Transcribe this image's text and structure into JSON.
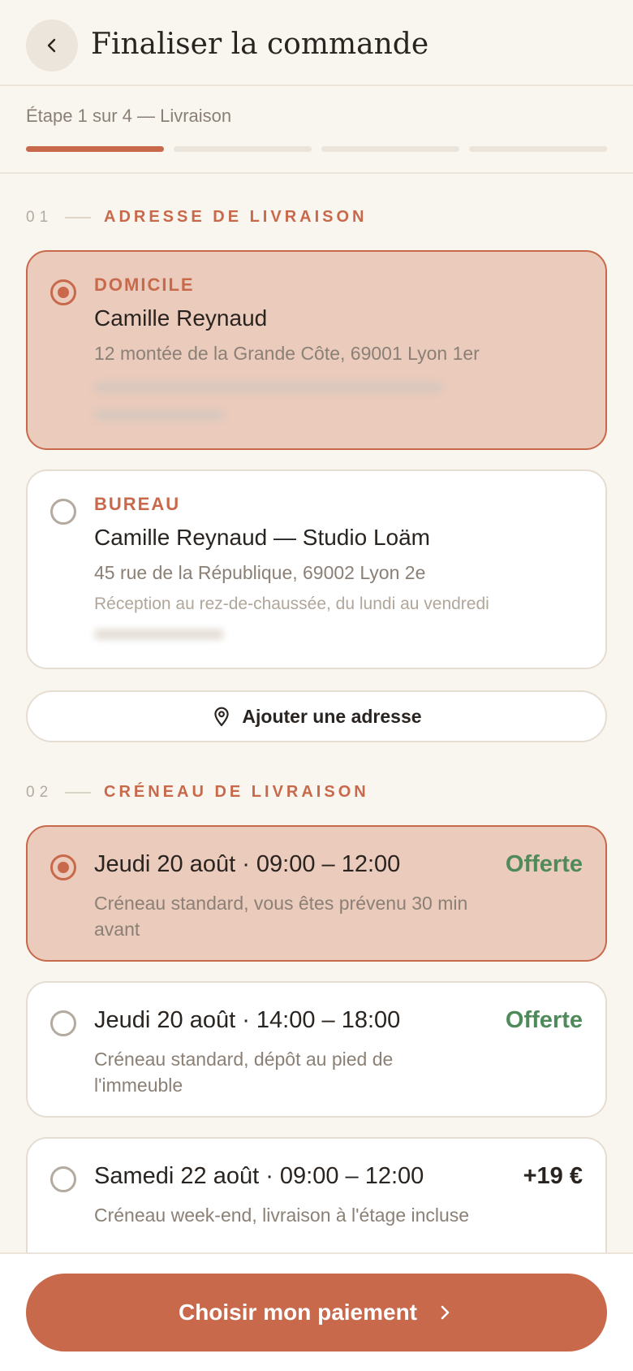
{
  "header": {
    "title": "Finaliser la commande",
    "back_icon": "chevron-left-icon"
  },
  "progress": {
    "label": "Étape 1 sur 4 — Livraison",
    "current_step": 1,
    "total_steps": 4
  },
  "sections": {
    "address": {
      "number": "01",
      "title": "ADRESSE DE LIVRAISON"
    },
    "slot": {
      "number": "02",
      "title": "CRÉNEAU DE LIVRAISON"
    }
  },
  "addresses": [
    {
      "tag": "DOMICILE",
      "name": "Camille Reynaud",
      "line": "12 montée de la Grande Côte, 69001 Lyon 1er",
      "note": "",
      "selected": true
    },
    {
      "tag": "BUREAU",
      "name": "Camille Reynaud — Studio Loäm",
      "line": "45 rue de la République, 69002 Lyon 2e",
      "note": "Réception au rez-de-chaussée, du lundi au vendredi",
      "selected": false
    }
  ],
  "add_address": {
    "label": "Ajouter une adresse",
    "icon": "map-pin-icon"
  },
  "slots": [
    {
      "title": "Jeudi 20 août · 09:00 – 12:00",
      "desc": "Créneau standard, vous êtes prévenu 30 min avant",
      "price": "Offerte",
      "selected": true
    },
    {
      "title": "Jeudi 20 août · 14:00 – 18:00",
      "desc": "Créneau standard, dépôt au pied de l'immeuble",
      "price": "Offerte",
      "selected": false
    },
    {
      "title": "Samedi 22 août · 09:00 – 12:00",
      "desc": "Créneau week-end, livraison à l'étage incluse",
      "price": "+19 €",
      "selected": false
    }
  ],
  "footer": {
    "cta_label": "Choisir mon paiement",
    "cta_icon": "chevron-right-icon"
  },
  "colors": {
    "accent": "#c8694b",
    "selected_bg": "#ebcbbc",
    "free": "#4f8a5a",
    "background": "#f9f5ef"
  }
}
